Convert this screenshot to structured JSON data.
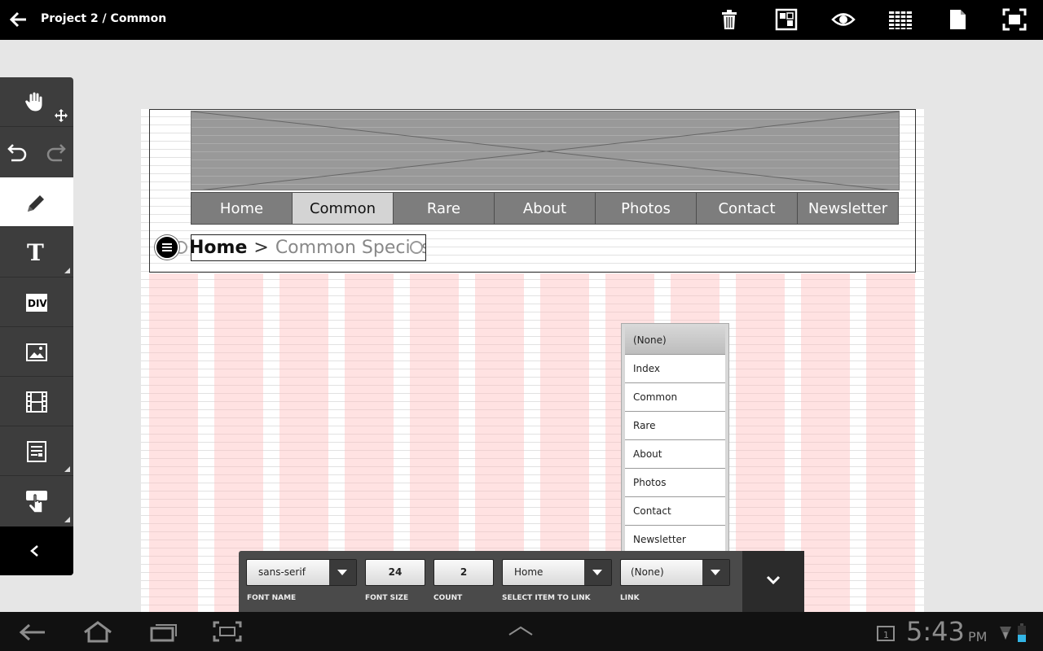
{
  "app": {
    "title": "Project 2 / Common",
    "actions": [
      "trash-icon",
      "grid-icon",
      "preview-icon",
      "layout-grid-icon",
      "page-icon",
      "fullscreen-icon"
    ]
  },
  "palette": {
    "tools": [
      "hand-tool",
      "undo-redo",
      "pencil-tool",
      "text-tool",
      "div-tool",
      "image-tool",
      "video-tool",
      "form-tool",
      "interaction-tool"
    ],
    "div_label": "DIV"
  },
  "canvas": {
    "nav": {
      "items": [
        "Home",
        "Common",
        "Rare",
        "About",
        "Photos",
        "Contact",
        "Newsletter"
      ],
      "active": "Common"
    },
    "breadcrumb": {
      "home": "Home",
      "separator": ">",
      "current": "Common Species"
    }
  },
  "dropdown": {
    "options": [
      "(None)",
      "Index",
      "Common",
      "Rare",
      "About",
      "Photos",
      "Contact",
      "Newsletter"
    ],
    "selected": "(None)"
  },
  "panel": {
    "font_name": {
      "label": "FONT NAME",
      "value": "sans-serif"
    },
    "font_size": {
      "label": "FONT SIZE",
      "value": "24"
    },
    "count": {
      "label": "COUNT",
      "value": "2"
    },
    "select_item": {
      "label": "SELECT ITEM TO LINK",
      "value": "Home"
    },
    "link": {
      "label": "LINK",
      "value": "(None)"
    }
  },
  "status": {
    "time": "5:43",
    "ampm": "PM"
  },
  "colors": {
    "accent_stripe": "#ffbebe",
    "nav_bg": "#7d7d7d",
    "nav_active": "#d4d4d4"
  }
}
